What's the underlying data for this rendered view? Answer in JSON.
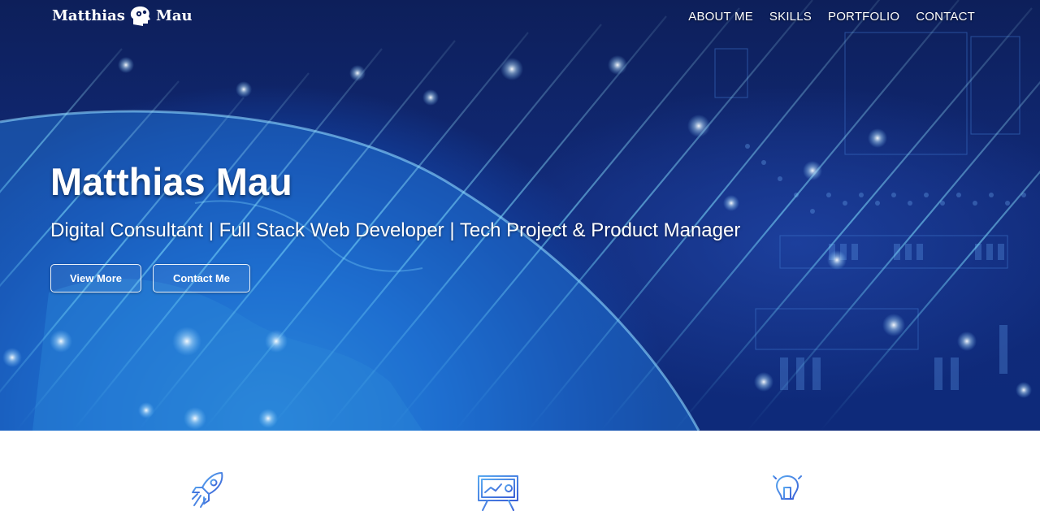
{
  "brand": {
    "name_left": "Matthias",
    "name_right": "Mau",
    "logo_icon": "head-gears-icon"
  },
  "nav": {
    "items": [
      {
        "label": "ABOUT ME"
      },
      {
        "label": "SKILLS"
      },
      {
        "label": "PORTFOLIO"
      },
      {
        "label": "CONTACT"
      }
    ]
  },
  "hero": {
    "title": "Matthias Mau",
    "subtitle": "Digital Consultant | Full Stack Web Developer | Tech Project & Product Manager",
    "buttons": {
      "view_more": "View More",
      "contact_me": "Contact Me"
    },
    "background": "earth-and-circuit-board-image"
  },
  "features": {
    "icons": [
      "rocket-icon",
      "presentation-board-icon",
      "lightbulb-icon"
    ]
  },
  "colors": {
    "hero_dark": "#0d1f5a",
    "hero_light": "#3aa7ea",
    "icon_blue": "#3b6fd8",
    "text": "#ffffff"
  }
}
